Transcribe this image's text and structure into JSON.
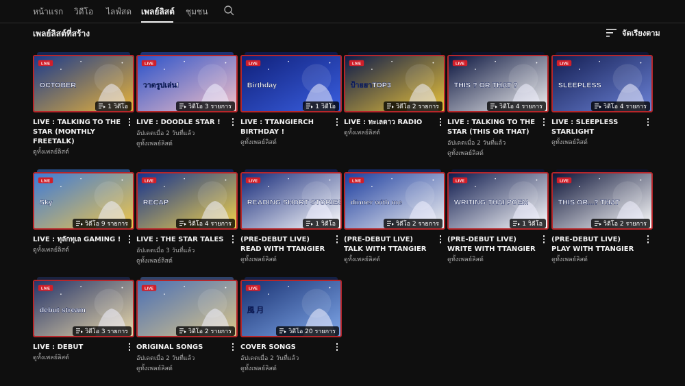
{
  "tabs": {
    "home": "หน้าแรก",
    "videos": "วิดีโอ",
    "live": "ไลฟ์สด",
    "playlists": "เพลย์ลิสต์",
    "community": "ชุมชน"
  },
  "section": {
    "title": "เพลย์ลิสต์ที่สร้าง",
    "sort_label": "จัดเรียงตาม"
  },
  "view_full_label": "ดูทั้งเพลย์ลิสต์",
  "playlists": [
    {
      "title": "LIVE : TALKING TO THE STAR (MONTHLY FREETALK)",
      "count": "1 วิดีโอ",
      "thumb_text": "OCTOBER",
      "colors": [
        "#1b3a8c",
        "#e8b33a"
      ]
    },
    {
      "title": "LIVE : DOODLE STAR !",
      "meta": "อัปเดตเมื่อ 2 วันที่แล้ว",
      "count": "วิดีโอ 3 รายการ",
      "thumb_text": "วาดรูปเล่น!",
      "colors": [
        "#2b52c9",
        "#f4c1c8"
      ]
    },
    {
      "title": "LIVE : TTANGIERCH BIRTHDAY !",
      "count": "1 วิดีโอ",
      "thumb_text": "Birthday",
      "colors": [
        "#10207a",
        "#3a5fe0"
      ]
    },
    {
      "title": "LIVE : ทะเลดาว RADIO",
      "count": "วิดีโอ 2 รายการ",
      "thumb_text": "ป้ายยาTOP3",
      "colors": [
        "#0f1c4a",
        "#e9c23a"
      ]
    },
    {
      "title": "LIVE : TALKING TO THE STAR (THIS OR THAT)",
      "meta": "อัปเดตเมื่อ 2 วันที่แล้ว",
      "count": "วิดีโอ 4 รายการ",
      "thumb_text": "THIS ? OR THAT ?",
      "colors": [
        "#0c1640",
        "#f1f1f1"
      ]
    },
    {
      "title": "LIVE : SLEEPLESS STARLIGHT",
      "count": "วิดีโอ 4 รายการ",
      "thumb_text": "SLEEPLESS",
      "colors": [
        "#141e52",
        "#6b82d6"
      ]
    },
    {
      "title": "LIVE : ทุลักทุเล GAMING !",
      "count": "วิดีโอ 9 รายการ",
      "thumb_text": "Sky",
      "colors": [
        "#3d7ad8",
        "#f0c64a"
      ]
    },
    {
      "title": "LIVE : THE STAR TALES",
      "meta": "อัปเดตเมื่อ 3 วันที่แล้ว",
      "count": "วิดีโอ 4 รายการ",
      "thumb_text": "RECAP",
      "colors": [
        "#14328f",
        "#f2d24a"
      ]
    },
    {
      "title": "(PRE-DEBUT LIVE) READ WITH TTANGIER",
      "count": "1 วิดีโอ",
      "thumb_text": "READING SHORT STORIES",
      "colors": [
        "#162a7a",
        "#ffffff"
      ]
    },
    {
      "title": "(PRE-DEBUT LIVE) TALK WITH TTANGIER",
      "count": "วิดีโอ 2 รายการ",
      "thumb_text": "dinner with me",
      "colors": [
        "#1d3ea0",
        "#f1f1f1"
      ]
    },
    {
      "title": "(PRE-DEBUT LIVE) WRITE WITH TTANGIER",
      "count": "1 วิดีโอ",
      "thumb_text": "WRITING THAI POEM",
      "colors": [
        "#0f1b4e",
        "#ffffff"
      ]
    },
    {
      "title": "(PRE-DEBUT LIVE) PLAY WITH TTANGIER",
      "count": "วิดีโอ 2 รายการ",
      "thumb_text": "THIS OR...? THAT",
      "colors": [
        "#0d1438",
        "#ffffff"
      ]
    },
    {
      "title": "LIVE : DEBUT",
      "count": "วิดีโอ 3 รายการ",
      "thumb_text": "debut stream",
      "colors": [
        "#25346a",
        "#e8d7a8"
      ]
    },
    {
      "title": "ORIGINAL SONGS",
      "meta": "อัปเดตเมื่อ 2 วันที่แล้ว",
      "count": "วิดีโอ 2 รายการ",
      "thumb_text": "",
      "colors": [
        "#4a6fb5",
        "#d9c58a"
      ]
    },
    {
      "title": "COVER SONGS",
      "meta": "อัปเดตเมื่อ 2 วันที่แล้ว",
      "count": "วิดีโอ 20 รายการ",
      "thumb_text": "風 月",
      "colors": [
        "#1a3272",
        "#7ea6e8"
      ]
    }
  ]
}
